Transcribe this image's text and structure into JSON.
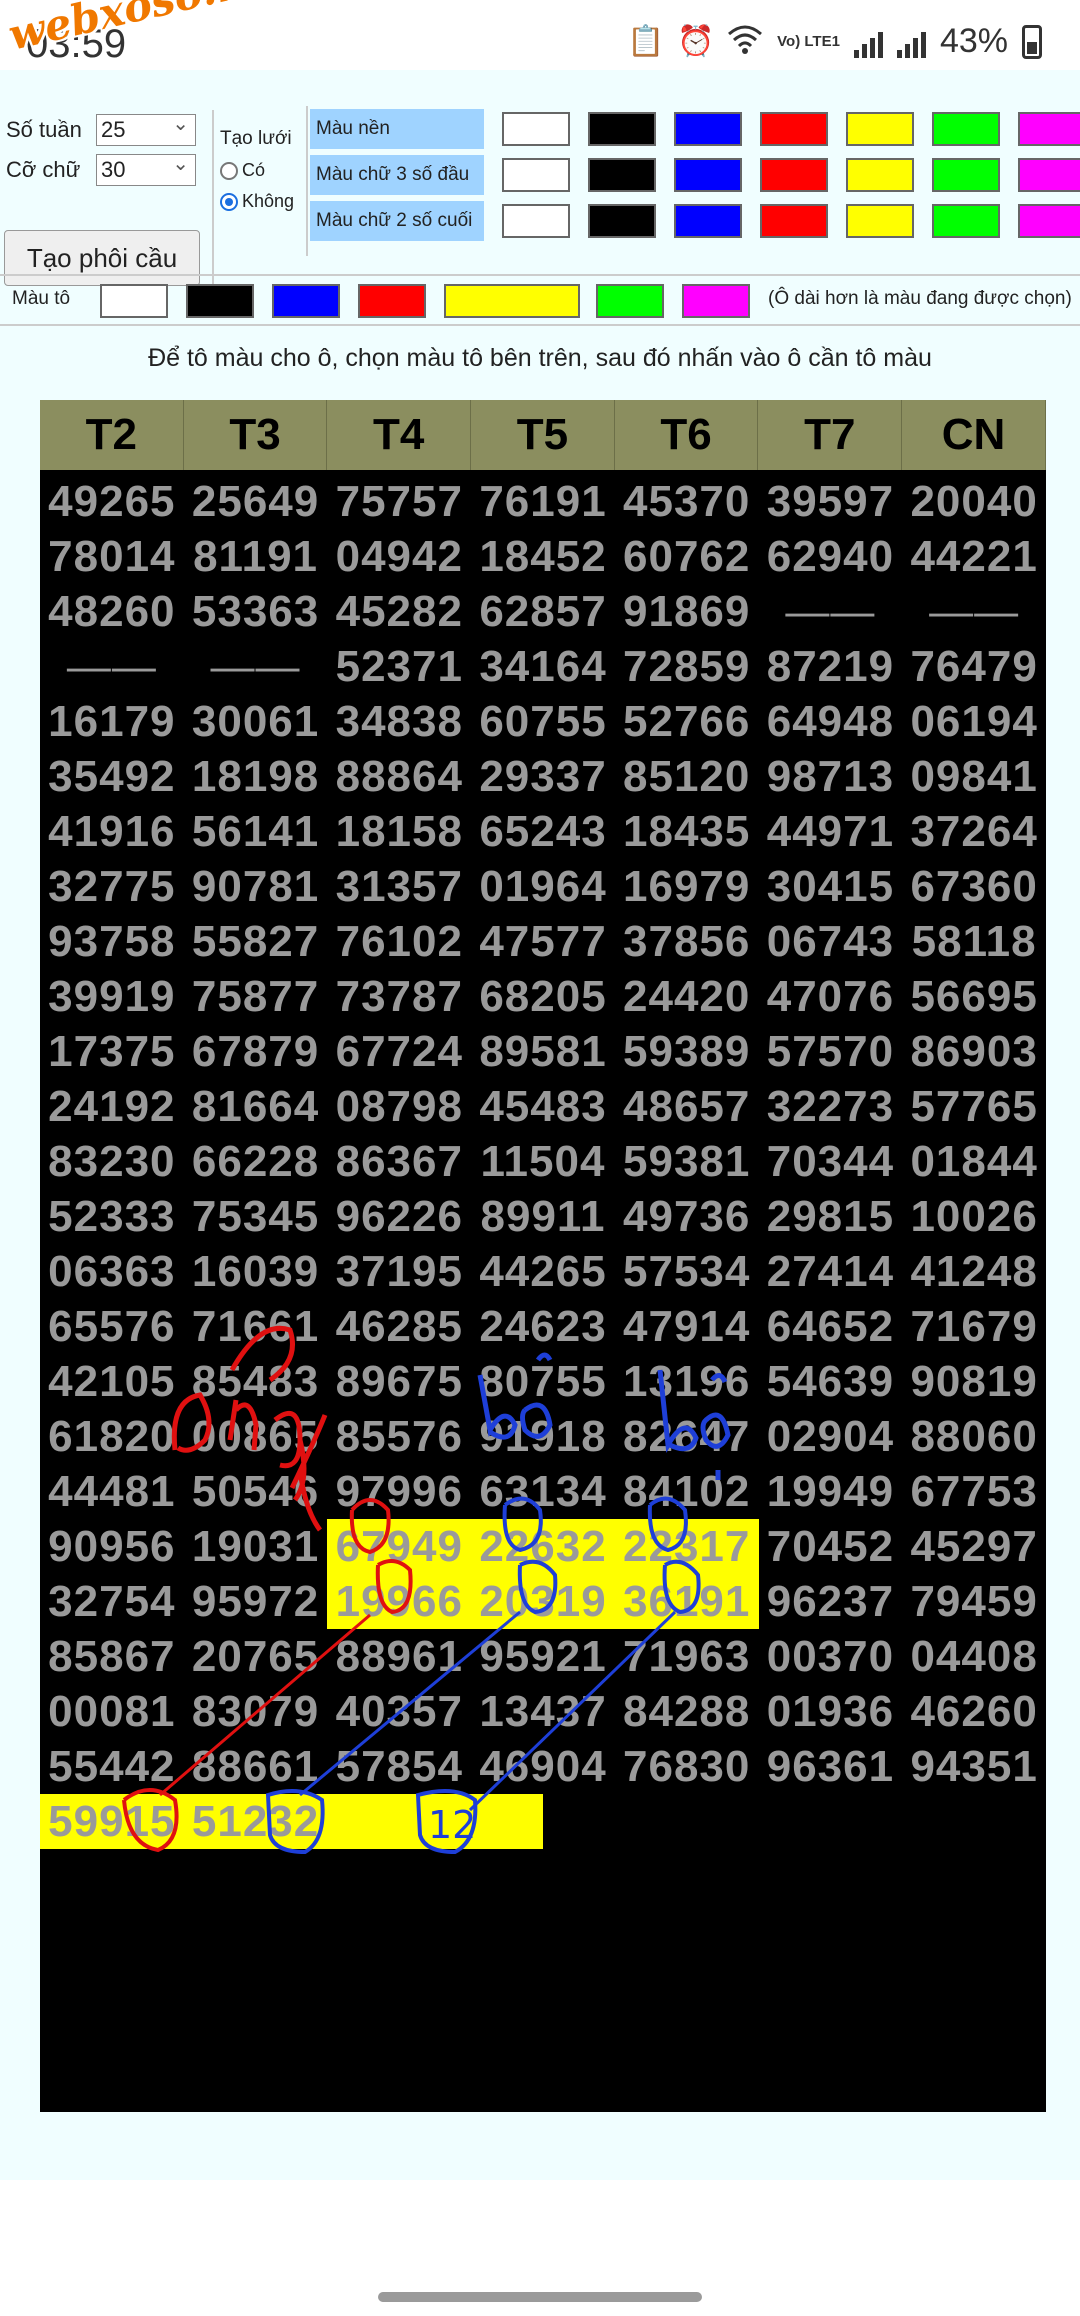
{
  "status": {
    "time": "03:59",
    "lte": "Vo) LTE1",
    "battery": "43%"
  },
  "watermark": "webxoso.net",
  "controls": {
    "week_label": "Số tuần",
    "week_value": "25",
    "font_label": "Cỡ chữ",
    "font_value": "30",
    "generate_button": "Tạo phôi cầu",
    "grid_label": "Tạo lưới",
    "grid_yes": "Có",
    "grid_no": "Không"
  },
  "color_rows": [
    {
      "label": "Màu nền"
    },
    {
      "label": "Màu chữ 3 số đầu"
    },
    {
      "label": "Màu chữ 2 số cuối"
    }
  ],
  "swatch_colors": [
    "#ffffff",
    "#000000",
    "#0000ff",
    "#ff0000",
    "#ffff00",
    "#00ff00",
    "#ff00ff"
  ],
  "paint": {
    "label": "Màu tô",
    "hint": "(Ô dài hơn là màu đang được chọn)",
    "selected": "#ffff00"
  },
  "instruction": "Để tô màu cho ô, chọn màu tô bên trên, sau đó nhấn vào ô cần tô màu",
  "board": {
    "headers": [
      "T2",
      "T3",
      "T4",
      "T5",
      "T6",
      "T7",
      "CN"
    ],
    "rows": [
      [
        "49265",
        "25649",
        "75757",
        "76191",
        "45370",
        "39597",
        "20040"
      ],
      [
        "78014",
        "81191",
        "04942",
        "18452",
        "60762",
        "62940",
        "44221"
      ],
      [
        "48260",
        "53363",
        "45282",
        "62857",
        "91869",
        "——",
        "——"
      ],
      [
        "——",
        "——",
        "52371",
        "34164",
        "72859",
        "87219",
        "76479"
      ],
      [
        "16179",
        "30061",
        "34838",
        "60755",
        "52766",
        "64948",
        "06194"
      ],
      [
        "35492",
        "18198",
        "88864",
        "29337",
        "85120",
        "98713",
        "09841"
      ],
      [
        "41916",
        "56141",
        "18158",
        "65243",
        "18435",
        "44971",
        "37264"
      ],
      [
        "32775",
        "90781",
        "31357",
        "01964",
        "16979",
        "30415",
        "67360"
      ],
      [
        "93758",
        "55827",
        "76102",
        "47577",
        "37856",
        "06743",
        "58118"
      ],
      [
        "39919",
        "75877",
        "73787",
        "68205",
        "24420",
        "47076",
        "56695"
      ],
      [
        "17375",
        "67879",
        "67724",
        "89581",
        "59389",
        "57570",
        "86903"
      ],
      [
        "24192",
        "81664",
        "08798",
        "45483",
        "48657",
        "32273",
        "57765"
      ],
      [
        "83230",
        "66228",
        "86367",
        "11504",
        "59381",
        "70344",
        "01844"
      ],
      [
        "52333",
        "75345",
        "96226",
        "89911",
        "49736",
        "29815",
        "10026"
      ],
      [
        "06363",
        "16039",
        "37195",
        "44265",
        "57534",
        "27414",
        "41248"
      ],
      [
        "65576",
        "71661",
        "46285",
        "24623",
        "47914",
        "64652",
        "71679"
      ],
      [
        "42105",
        "85483",
        "89675",
        "80755",
        "13196",
        "54639",
        "90819"
      ],
      [
        "61820",
        "00865",
        "85576",
        "91918",
        "82647",
        "02904",
        "88060"
      ],
      [
        "44481",
        "50546",
        "97996",
        "63134",
        "84102",
        "19949",
        "67753"
      ],
      [
        "90956",
        "19031",
        "67949",
        "22632",
        "22317",
        "70452",
        "45297"
      ],
      [
        "32754",
        "95972",
        "19966",
        "20319",
        "36191",
        "96237",
        "79459"
      ],
      [
        "85867",
        "20765",
        "88961",
        "95921",
        "71963",
        "00370",
        "04408"
      ],
      [
        "00081",
        "83079",
        "40357",
        "13437",
        "84288",
        "01936",
        "46260"
      ],
      [
        "55442",
        "88661",
        "57854",
        "46904",
        "76830",
        "96361",
        "94351"
      ],
      [
        "59915",
        "51232",
        "",
        "",
        "",
        "",
        ""
      ]
    ],
    "highlighted": [
      [
        19,
        2
      ],
      [
        19,
        3
      ],
      [
        19,
        4
      ],
      [
        20,
        2
      ],
      [
        20,
        3
      ],
      [
        20,
        4
      ],
      [
        24,
        0
      ],
      [
        24,
        1
      ]
    ]
  },
  "annotations": {
    "red_text": "Tong",
    "blue_text_1": "bỏ",
    "blue_text_2": "bỏ",
    "blue_box_number": "12"
  }
}
